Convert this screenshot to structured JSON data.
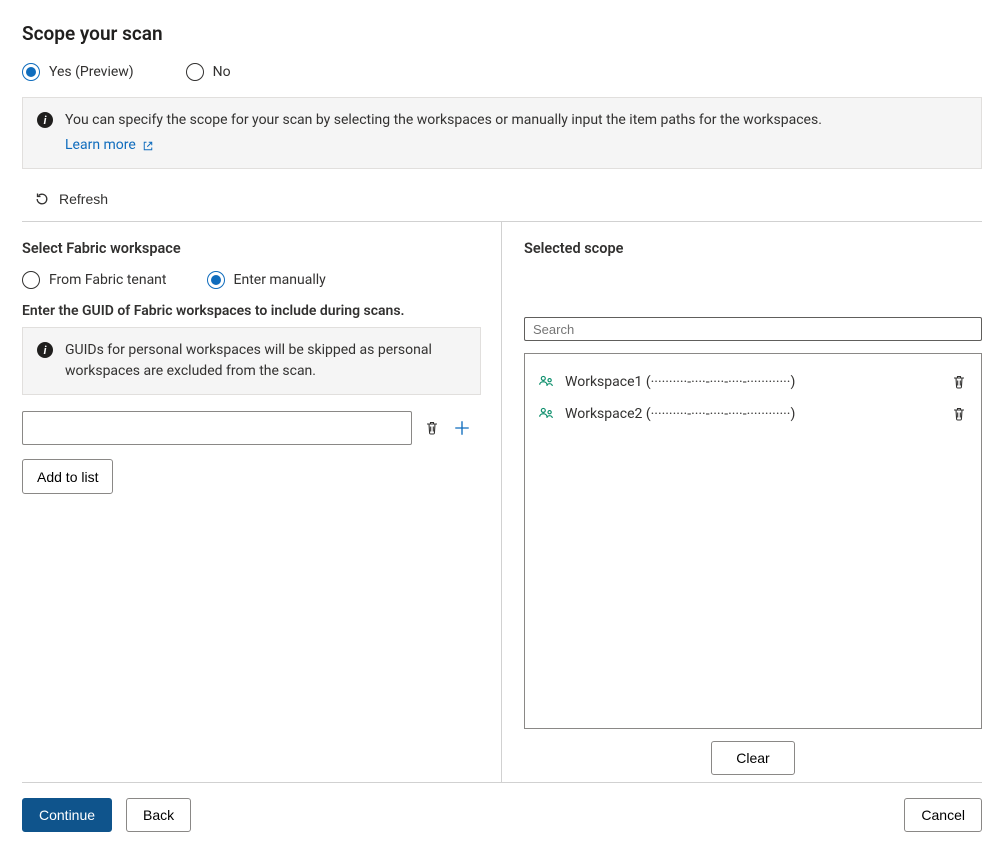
{
  "page": {
    "title": "Scope your scan"
  },
  "scope_toggle": {
    "yes_label": "Yes (Preview)",
    "no_label": "No",
    "selected": "yes"
  },
  "info_banner": {
    "text": "You can specify the scope for your scan by selecting the workspaces or manually input the item paths for the workspaces.",
    "learn_more": "Learn more"
  },
  "refresh_label": "Refresh",
  "left": {
    "section_title": "Select Fabric workspace",
    "from_tenant_label": "From Fabric tenant",
    "enter_manually_label": "Enter manually",
    "source_selected": "manual",
    "guid_heading": "Enter the GUID of Fabric workspaces to include during scans.",
    "guid_note": "GUIDs for personal workspaces will be skipped as personal workspaces are excluded from the scan.",
    "guid_input_value": "",
    "add_to_list": "Add to list"
  },
  "right": {
    "section_title": "Selected scope",
    "search_placeholder": "Search",
    "items": [
      {
        "name": "Workspace1",
        "guid_display": "(··········-····-····-····-············)"
      },
      {
        "name": "Workspace2",
        "guid_display": "(··········-····-····-····-············)"
      }
    ],
    "clear": "Clear"
  },
  "footer": {
    "continue": "Continue",
    "back": "Back",
    "cancel": "Cancel"
  }
}
